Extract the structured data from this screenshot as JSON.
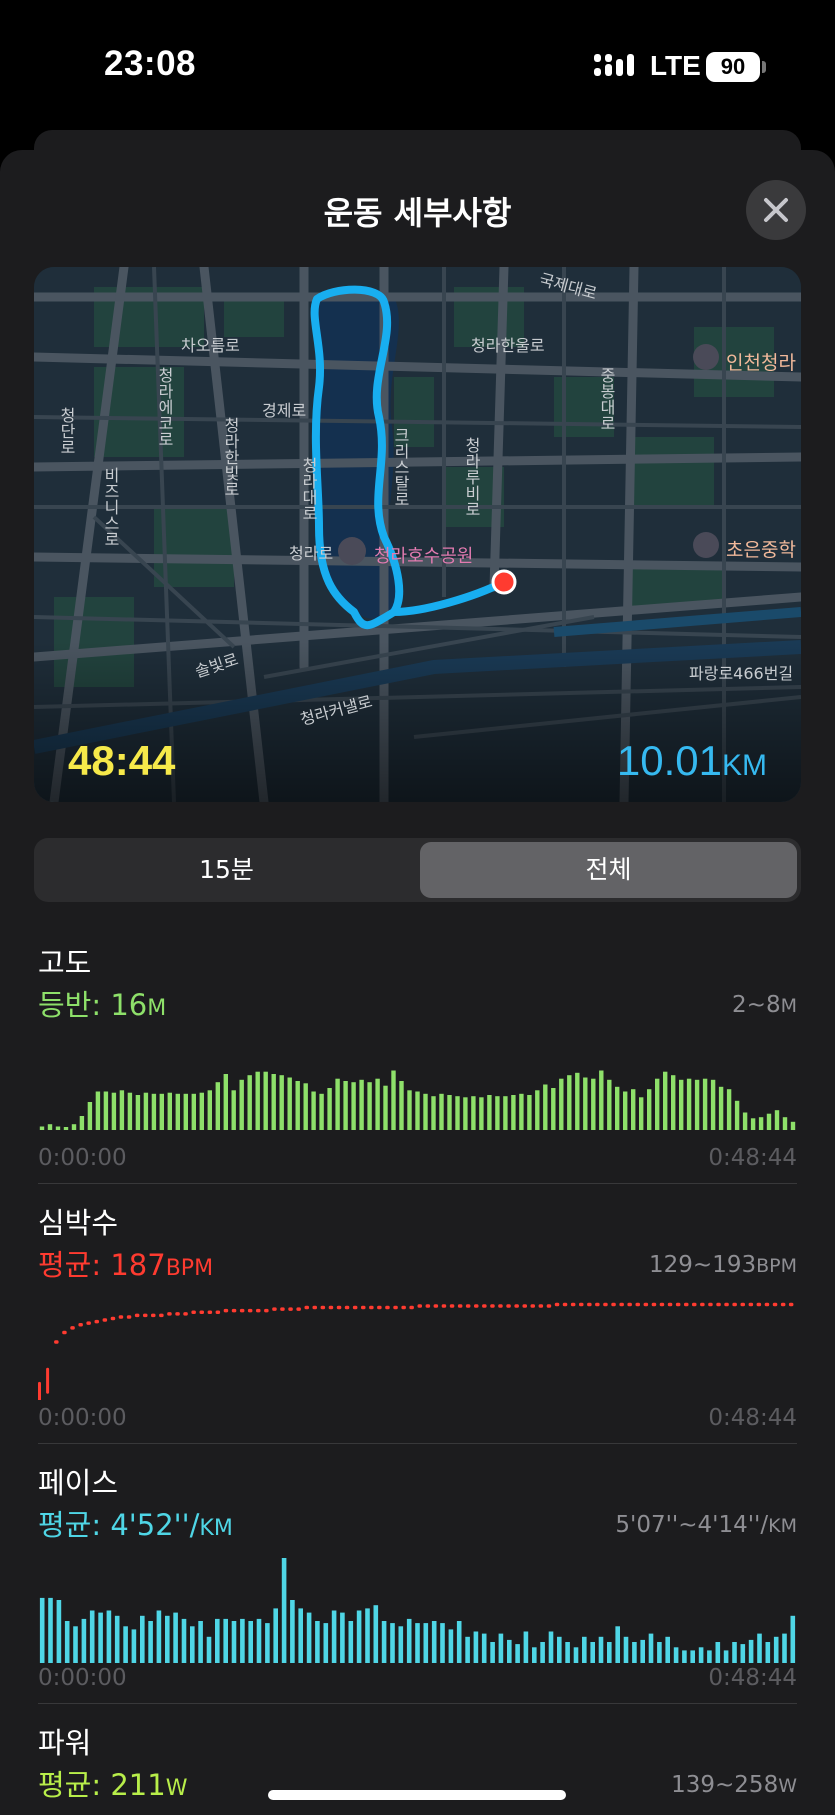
{
  "status": {
    "time": "23:08",
    "network": "LTE",
    "battery": "90"
  },
  "sheet": {
    "title": "운동 세부사항"
  },
  "map": {
    "duration": "48:44",
    "distance_value": "10.01",
    "distance_unit": "KM",
    "labels": {
      "gukje": "국제대로",
      "chao": "차오름로",
      "cheongra_hanul": "청라한울로",
      "incheon": "인천청라",
      "gyeongje": "경제로",
      "jungbong": "중봉대로",
      "cheongra_eco": "청라에코로",
      "cheongdan": "청단로",
      "bizeu": "비즈니스로",
      "cheongra_hanbit": "청라한빛로",
      "cheongra_daero": "청라대로",
      "crystal": "크리스탈로",
      "cheongra_lumi": "청라루비로",
      "cheong": "청라로",
      "lake_park": "청라호수공원",
      "choeun": "초은중학",
      "solbit": "솔빛로",
      "canal": "청라커낼로",
      "parang": "파랑로466번길"
    }
  },
  "segmented": {
    "option1": "15분",
    "option2": "전체",
    "selected": "전체"
  },
  "colors": {
    "elevation": "#8ee06a",
    "heart": "#ff3b30",
    "pace": "#4fd6e6",
    "power": "#b8ee4a",
    "route": "#18aef0"
  },
  "metrics": {
    "elevation": {
      "title": "고도",
      "avg_label": "등반:",
      "avg_value": "16",
      "avg_unit": "M",
      "range": "2~8",
      "range_unit": "M",
      "start": "0:00:00",
      "end": "0:48:44"
    },
    "heart": {
      "title": "심박수",
      "avg_label": "평균:",
      "avg_value": "187",
      "avg_unit": "BPM",
      "range": "129~193",
      "range_unit": "BPM",
      "start": "0:00:00",
      "end": "0:48:44"
    },
    "pace": {
      "title": "페이스",
      "avg_label": "평균:",
      "avg_value": "4'52''/",
      "avg_unit": "KM",
      "range": "5'07''~4'14''/",
      "range_unit": "KM",
      "start": "0:00:00",
      "end": "0:48:44"
    },
    "power": {
      "title": "파워",
      "avg_label": "평균:",
      "avg_value": "211",
      "avg_unit": "W",
      "range": "139~258",
      "range_unit": "W"
    }
  },
  "chart_data": [
    {
      "type": "bar",
      "title": "고도",
      "xlim": [
        "0:00:00",
        "0:48:44"
      ],
      "ylim": [
        2,
        8
      ],
      "values": [
        2.3,
        2.5,
        2.3,
        2.2,
        2.5,
        3.2,
        4.4,
        5.3,
        5.3,
        5.2,
        5.4,
        5.2,
        5.0,
        5.2,
        5.1,
        5.1,
        5.2,
        5.1,
        5.1,
        5.1,
        5.2,
        5.4,
        6.1,
        6.8,
        5.4,
        6.3,
        6.7,
        7.0,
        7.0,
        6.8,
        6.7,
        6.5,
        6.2,
        6.0,
        5.3,
        5.1,
        5.6,
        6.4,
        6.2,
        6.1,
        6.3,
        6.1,
        6.4,
        5.8,
        7.1,
        6.2,
        5.4,
        5.3,
        5.1,
        4.9,
        5.1,
        5.0,
        4.9,
        4.8,
        4.9,
        4.8,
        5.0,
        4.9,
        4.9,
        5.0,
        5.1,
        5.0,
        5.4,
        5.9,
        5.6,
        6.4,
        6.7,
        6.9,
        6.5,
        6.4,
        7.1,
        6.3,
        5.7,
        5.3,
        5.5,
        4.8,
        5.5,
        6.4,
        7.0,
        6.7,
        6.3,
        6.4,
        6.3,
        6.4,
        6.3,
        5.7,
        5.5,
        4.5,
        3.5,
        3.0,
        3.1,
        3.4,
        3.7,
        3.1,
        2.7
      ]
    },
    {
      "type": "line",
      "title": "심박수",
      "xlim": [
        "0:00:00",
        "0:48:44"
      ],
      "ylim": [
        129,
        193
      ],
      "values": [
        131,
        140,
        166,
        172,
        175,
        177,
        178,
        179,
        180,
        181,
        182,
        182,
        183,
        183,
        183,
        183,
        184,
        184,
        184,
        185,
        185,
        185,
        185,
        186,
        186,
        186,
        186,
        186,
        186,
        187,
        187,
        187,
        187,
        188,
        188,
        188,
        188,
        188,
        188,
        188,
        188,
        188,
        188,
        188,
        188,
        188,
        188,
        189,
        189,
        189,
        189,
        189,
        189,
        189,
        189,
        189,
        189,
        189,
        189,
        189,
        189,
        189,
        189,
        189,
        190,
        190,
        190,
        190,
        190,
        190,
        190,
        190,
        190,
        190,
        190,
        190,
        190,
        190,
        190,
        190,
        190,
        190,
        190,
        190,
        190,
        190,
        190,
        190,
        190,
        190,
        190,
        190,
        190,
        190,
        191
      ]
    },
    {
      "type": "bar",
      "title": "페이스",
      "xlim": [
        "0:00:00",
        "0:48:44"
      ],
      "values": [
        0.62,
        0.62,
        0.6,
        0.4,
        0.35,
        0.42,
        0.5,
        0.48,
        0.5,
        0.45,
        0.35,
        0.32,
        0.45,
        0.4,
        0.5,
        0.45,
        0.48,
        0.42,
        0.35,
        0.4,
        0.25,
        0.42,
        0.42,
        0.4,
        0.42,
        0.4,
        0.42,
        0.38,
        0.52,
        1.0,
        0.6,
        0.52,
        0.48,
        0.4,
        0.38,
        0.5,
        0.48,
        0.4,
        0.5,
        0.52,
        0.55,
        0.4,
        0.38,
        0.35,
        0.42,
        0.38,
        0.38,
        0.4,
        0.38,
        0.32,
        0.4,
        0.25,
        0.3,
        0.28,
        0.2,
        0.28,
        0.22,
        0.18,
        0.3,
        0.15,
        0.2,
        0.3,
        0.25,
        0.2,
        0.15,
        0.25,
        0.2,
        0.25,
        0.2,
        0.35,
        0.25,
        0.2,
        0.22,
        0.28,
        0.2,
        0.25,
        0.15,
        0.12,
        0.12,
        0.15,
        0.12,
        0.2,
        0.12,
        0.2,
        0.18,
        0.22,
        0.28,
        0.2,
        0.25,
        0.28,
        0.45
      ]
    }
  ]
}
